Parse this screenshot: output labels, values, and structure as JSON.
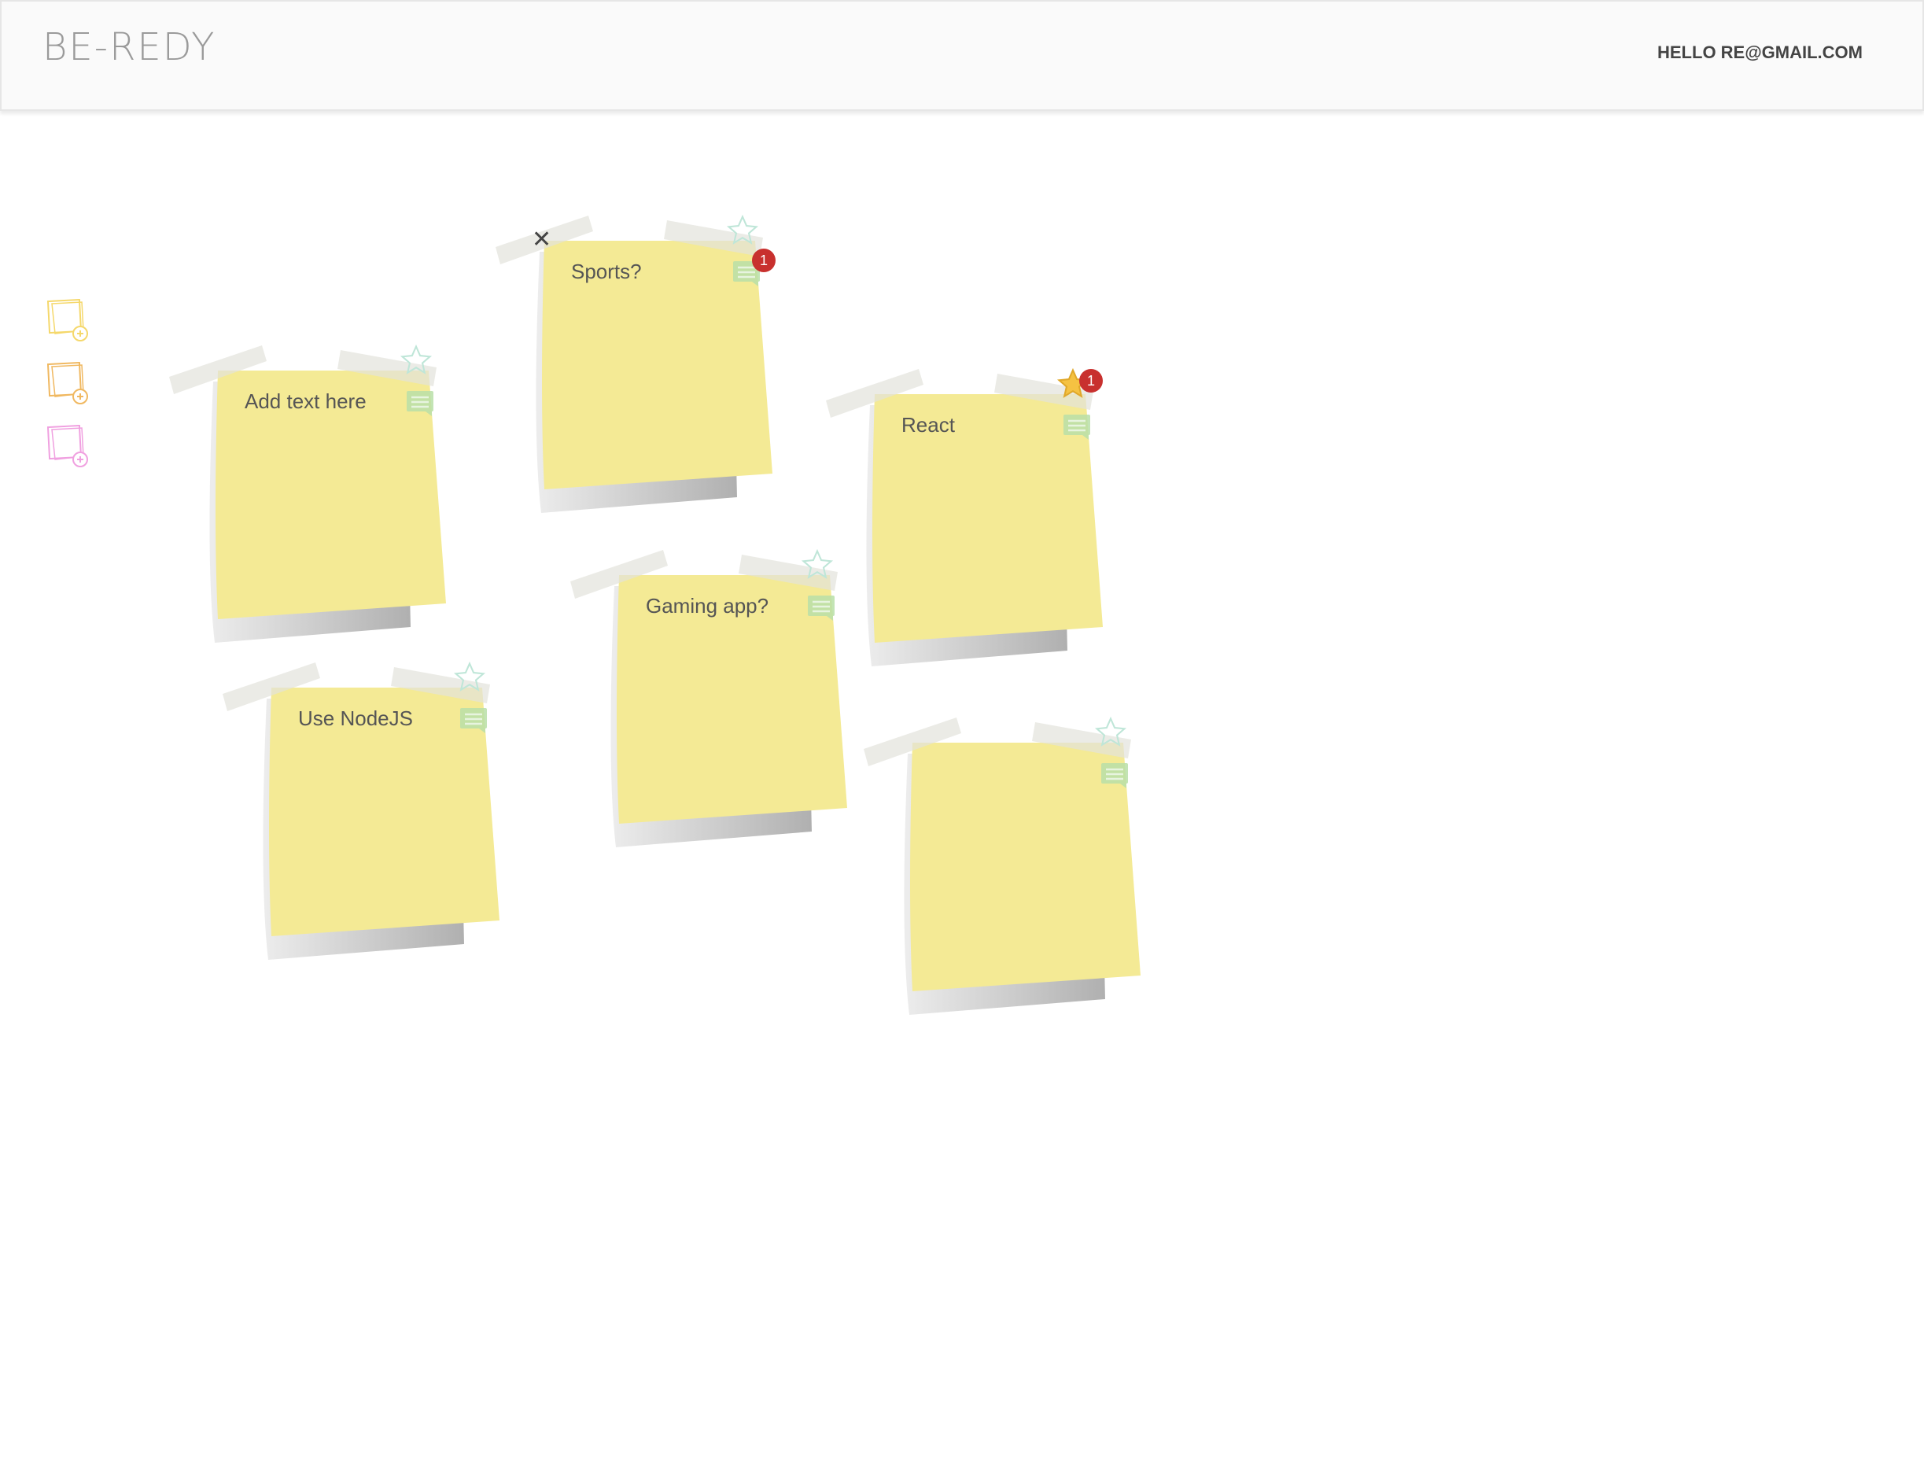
{
  "header": {
    "logo": "BE-REDY",
    "greeting": "HELLO RE@GMAIL.COM"
  },
  "side_tools": [
    {
      "name": "add-yellow-note",
      "color": "#f5d86b"
    },
    {
      "name": "add-orange-note",
      "color": "#f0b860"
    },
    {
      "name": "add-pink-note",
      "color": "#f0a0e0"
    }
  ],
  "notes": [
    {
      "text": "Sports?",
      "starred": false,
      "comment_count": "1",
      "star_count": "",
      "show_close": true
    },
    {
      "text": "Add text here",
      "starred": false,
      "comment_count": "",
      "star_count": "",
      "show_close": false
    },
    {
      "text": "React",
      "starred": true,
      "comment_count": "",
      "star_count": "1",
      "show_close": false
    },
    {
      "text": "Gaming app?",
      "starred": false,
      "comment_count": "",
      "star_count": "",
      "show_close": false
    },
    {
      "text": "Use NodeJS",
      "starred": false,
      "comment_count": "",
      "star_count": "",
      "show_close": false
    },
    {
      "text": "",
      "starred": false,
      "comment_count": "",
      "star_count": "",
      "show_close": false
    }
  ],
  "colors": {
    "note": "#f4ea95",
    "tape": "#e2e2dc",
    "badge": "#c8302e",
    "star_active": "#f5c242",
    "comment_icon": "#b9dfa8"
  }
}
